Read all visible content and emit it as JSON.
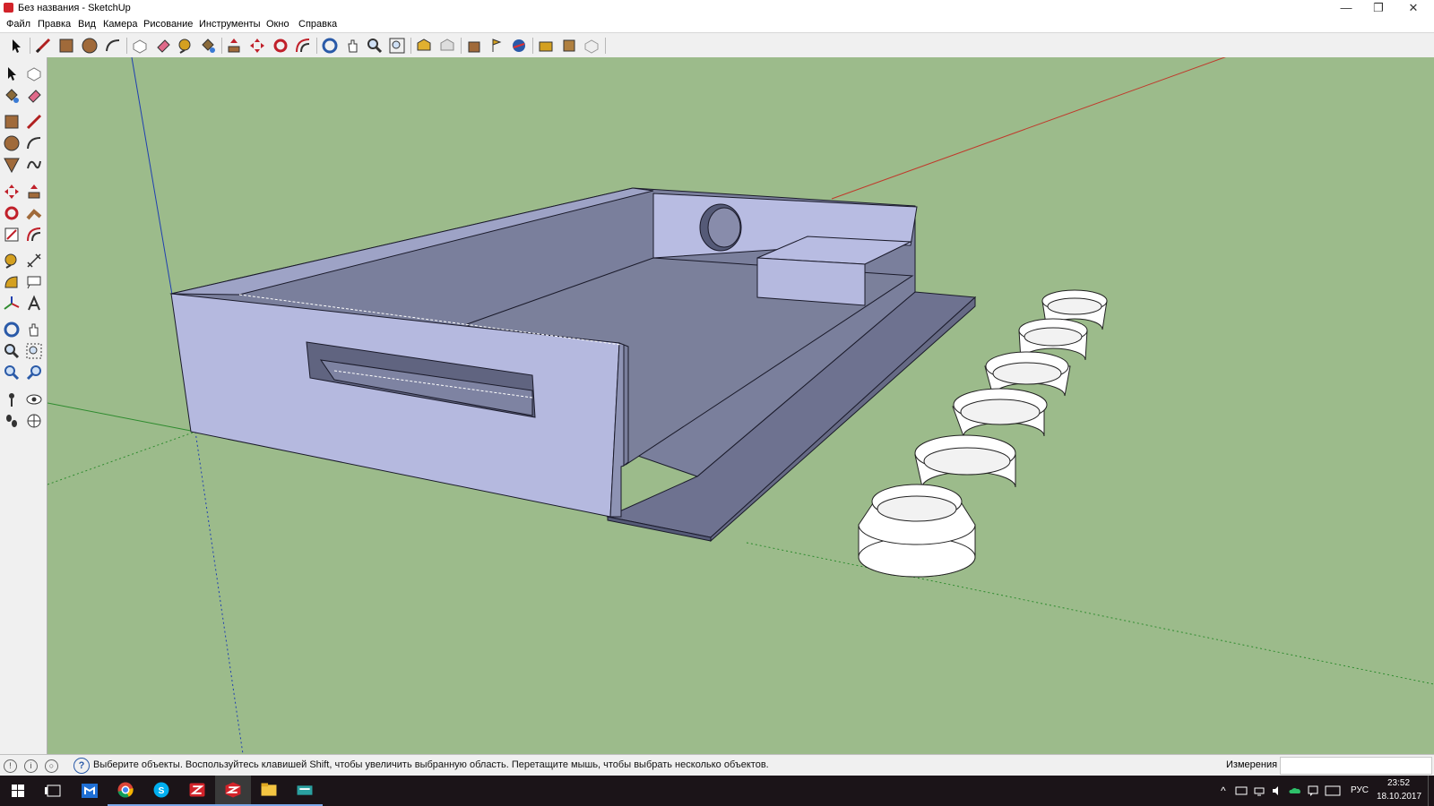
{
  "window": {
    "title": "Без названия - SketchUp",
    "controls": {
      "minimize": "—",
      "restore": "❐",
      "close": "✕"
    }
  },
  "menu": [
    "Файл",
    "Правка",
    "Вид",
    "Камера",
    "Рисование",
    "Инструменты",
    "Окно",
    "Справка"
  ],
  "toolbar_top": [
    "select-tool-icon",
    "line-tool-icon",
    "rectangle-tool-icon",
    "circle-tool-icon",
    "arc-tool-icon",
    "make-component-icon",
    "eraser-tool-icon",
    "tape-measure-icon",
    "paint-bucket-icon",
    "push-pull-icon",
    "move-tool-icon",
    "rotate-tool-icon",
    "offset-tool-icon",
    "orbit-tool-icon",
    "pan-tool-icon",
    "zoom-tool-icon",
    "zoom-extents-icon",
    "3d-warehouse-icon",
    "share-model-icon",
    "get-models-icon",
    "add-location-icon",
    "geo-toggle-icon",
    "extension-warehouse-icon",
    "share-component-icon",
    "layout-icon"
  ],
  "toolbar_left": [
    "select-tool-icon",
    "make-component-icon",
    "paint-bucket-icon",
    "eraser-tool-icon",
    "rectangle-tool-icon",
    "line-tool-icon",
    "circle-tool-icon",
    "arc-tool-icon",
    "polygon-tool-icon",
    "freehand-tool-icon",
    "move-tool-icon",
    "push-pull-icon",
    "rotate-tool-icon",
    "follow-me-icon",
    "scale-tool-icon",
    "offset-tool-icon",
    "tape-measure-icon",
    "dimension-tool-icon",
    "protractor-tool-icon",
    "text-tool-icon",
    "axes-tool-icon",
    "3d-text-icon",
    "orbit-tool-icon",
    "pan-tool-icon",
    "zoom-tool-icon",
    "zoom-window-icon",
    "previous-view-icon",
    "next-view-icon",
    "position-camera-icon",
    "look-around-icon",
    "walk-tool-icon",
    "section-plane-icon"
  ],
  "colors": {
    "viewport_bg": "#9cbb8b",
    "face_front": "#b6bbe0",
    "face_back": "#7a7f9c",
    "axis_red": "#c0392b",
    "axis_green": "#2e8b2e",
    "axis_blue": "#1f3fb0"
  },
  "status": {
    "hint": "Выберите объекты. Воспользуйтесь клавишей Shift, чтобы увеличить выбранную область. Перетащите мышь, чтобы выбрать несколько объектов.",
    "measurements_label": "Измерения",
    "measurements_value": ""
  },
  "taskbar": {
    "apps": [
      "windows-start-icon",
      "task-view-icon",
      "store-icon",
      "chrome-icon",
      "skype-icon",
      "sketchup-layout-icon",
      "sketchup-icon",
      "file-explorer-icon",
      "keyboard-app-icon"
    ],
    "language": "РУС",
    "time": "23:52",
    "date": "18.10.2017"
  }
}
